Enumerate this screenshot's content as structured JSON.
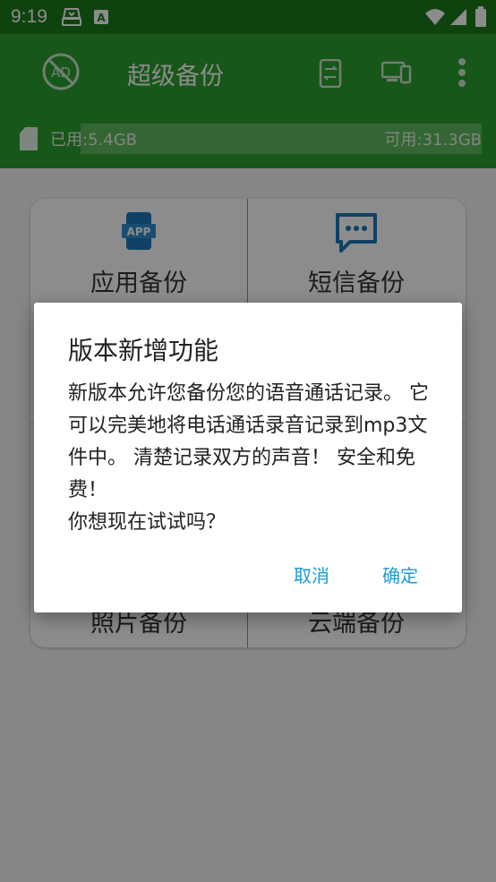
{
  "status_bar": {
    "time": "9:19",
    "icons": [
      "sim-toolkit-icon",
      "keyboard-a-icon",
      "wifi-icon",
      "signal-icon",
      "battery-icon"
    ]
  },
  "app": {
    "title": "超级备份",
    "colors": {
      "statusbar": "#1a7a1a",
      "toolbar": "#2a9e2f",
      "accent": "#1b9bd6"
    },
    "storage": {
      "used_label": "已用:5.4GB",
      "free_label": "可用:31.3GB",
      "used_fraction": 0.148
    }
  },
  "grid": {
    "items": [
      {
        "label": "应用备份",
        "icon": "app-icon"
      },
      {
        "label": "短信备份",
        "icon": "sms-icon"
      },
      {
        "label": "照片备份",
        "icon": "photo-icon"
      },
      {
        "label": "云端备份",
        "icon": "cloud-icon"
      }
    ]
  },
  "dialog": {
    "title": "版本新增功能",
    "message": "新版本允许您备份您的语音通话记录。 它可以完美地将电话通话录音记录到mp3文件中。 清楚记录双方的声音！ 安全和免费！\n你想现在试试吗？",
    "cancel": "取消",
    "confirm": "确定"
  }
}
